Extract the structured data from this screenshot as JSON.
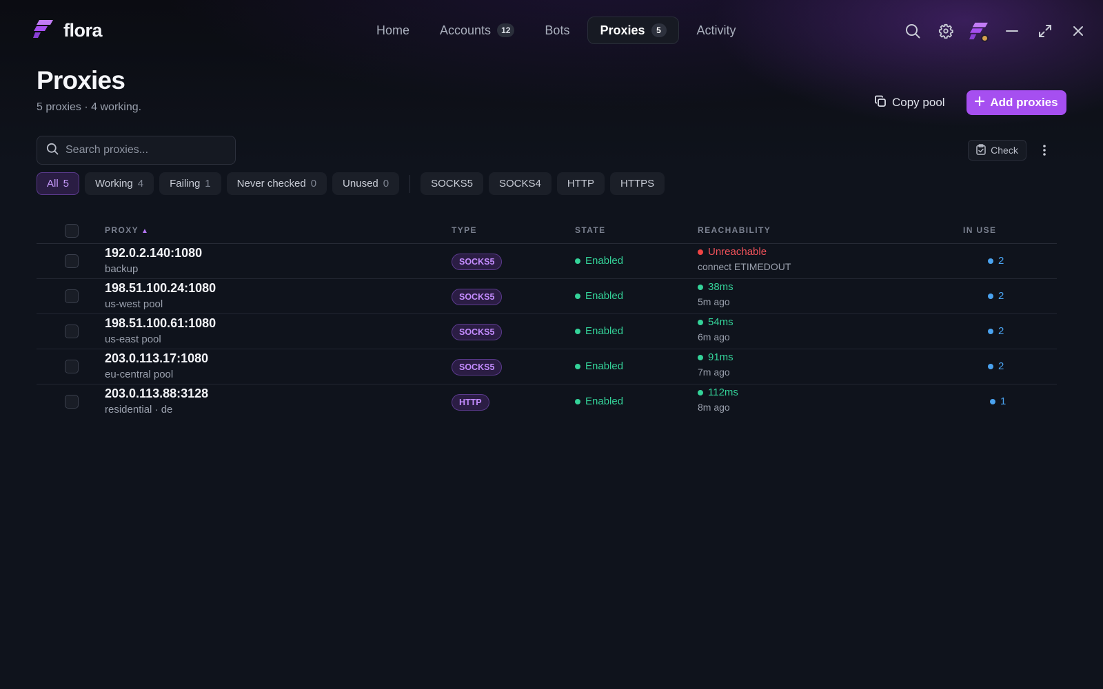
{
  "app": {
    "name": "flora",
    "accent": "#a64ff0"
  },
  "nav": {
    "items": [
      {
        "label": "Home",
        "badge": ""
      },
      {
        "label": "Accounts",
        "badge": "12"
      },
      {
        "label": "Bots",
        "badge": ""
      },
      {
        "label": "Proxies",
        "badge": "5",
        "active": true
      },
      {
        "label": "Activity",
        "badge": ""
      }
    ]
  },
  "header": {
    "title": "Proxies",
    "subtitle": "5 proxies · 4 working.",
    "copy_label": "Copy pool",
    "add_label": "Add proxies"
  },
  "search": {
    "placeholder": "Search proxies...",
    "value": ""
  },
  "toolbar": {
    "check_label": "Check"
  },
  "filters": {
    "status": [
      {
        "label": "All",
        "count": "5",
        "active": true
      },
      {
        "label": "Working",
        "count": "4"
      },
      {
        "label": "Failing",
        "count": "1"
      },
      {
        "label": "Never checked",
        "count": "0"
      },
      {
        "label": "Unused",
        "count": "0"
      }
    ],
    "types": [
      "SOCKS5",
      "SOCKS4",
      "HTTP",
      "HTTPS"
    ]
  },
  "table": {
    "columns": {
      "proxy": "PROXY",
      "type": "TYPE",
      "state": "STATE",
      "reachability": "REACHABILITY",
      "in_use": "IN USE"
    },
    "rows": [
      {
        "address": "192.0.2.140:1080",
        "label": "backup",
        "type": "SOCKS5",
        "state": "Enabled",
        "reach": "Unreachable",
        "reach_status": "bad",
        "reach_sub": "connect ETIMEDOUT",
        "in_use": "2"
      },
      {
        "address": "198.51.100.24:1080",
        "label": "us-west pool",
        "type": "SOCKS5",
        "state": "Enabled",
        "reach": "38ms",
        "reach_status": "ok",
        "reach_sub": "5m ago",
        "in_use": "2"
      },
      {
        "address": "198.51.100.61:1080",
        "label": "us-east pool",
        "type": "SOCKS5",
        "state": "Enabled",
        "reach": "54ms",
        "reach_status": "ok",
        "reach_sub": "6m ago",
        "in_use": "2"
      },
      {
        "address": "203.0.113.17:1080",
        "label": "eu-central pool",
        "type": "SOCKS5",
        "state": "Enabled",
        "reach": "91ms",
        "reach_status": "ok",
        "reach_sub": "7m ago",
        "in_use": "2"
      },
      {
        "address": "203.0.113.88:3128",
        "label": "residential · de",
        "type": "HTTP",
        "state": "Enabled",
        "reach": "112ms",
        "reach_status": "ok",
        "reach_sub": "8m ago",
        "in_use": "1"
      }
    ]
  },
  "icons": {
    "logo": "flora-logo-icon",
    "search": "search-icon",
    "settings": "gear-icon",
    "minimize": "minimize-icon",
    "maximize": "expand-icon",
    "close": "close-icon",
    "copy": "copy-icon",
    "add": "plus-icon",
    "check": "clipboard-check-icon",
    "more": "more-vertical-icon"
  }
}
